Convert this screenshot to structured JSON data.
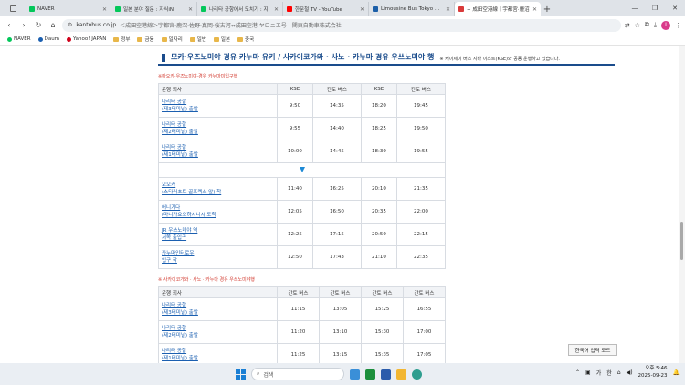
{
  "browser": {
    "tabs": [
      {
        "title": "NAVER",
        "color": "#03c75a",
        "active": false
      },
      {
        "title": "일본 분야 질문 : 지식iN",
        "color": "#03c75a",
        "active": false
      },
      {
        "title": "나리타 공항에서 도치기 : 지",
        "color": "#03c75a",
        "active": false
      },
      {
        "title": "한문철 TV - YouTube",
        "color": "#ff0000",
        "active": false
      },
      {
        "title": "Limousine Bus Tokyo Airpo",
        "color": "#1c5fa8",
        "active": false
      },
      {
        "title": "+ 成田空港線｜宇都宮·鹿沼",
        "color": "#d93a3a",
        "active": true
      }
    ],
    "new_tab": "+",
    "address": {
      "domain": "kantobus.co.jp",
      "path": "＜成田空港線＞宇都宮·鹿沼·佐野·真岡·桜古河⇔成田空港 ヤロニエ号 - 関東自動車株式会社"
    },
    "bookmarks": [
      {
        "label": "NAVER",
        "type": "dot",
        "color": "#03c75a"
      },
      {
        "label": "Daum",
        "type": "dot",
        "color": "#1b5fb0"
      },
      {
        "label": "Yahoo! JAPAN",
        "type": "dot",
        "color": "#d0021b"
      },
      {
        "label": "정부",
        "type": "folder"
      },
      {
        "label": "금융",
        "type": "folder"
      },
      {
        "label": "일자리",
        "type": "folder"
      },
      {
        "label": "일반",
        "type": "folder"
      },
      {
        "label": "일본",
        "type": "folder"
      },
      {
        "label": "중국",
        "type": "folder"
      }
    ],
    "profile_initial": "I"
  },
  "page": {
    "route_title": "모카·우즈노미야 경유 카누마 유키 / 사카이코가와 · 사노 · 카누마 경유 우쓰노미야 행",
    "route_note": "※ 케이세이 버스 지바 이스트(KSE)와 공동 운행하고 있습니다.",
    "table1": {
      "caption": "※마오카·우즈노미야·경유 카누마미입구행",
      "headers": [
        "운행 회사",
        "KSE",
        "간토 버스",
        "KSE",
        "간토 버스"
      ],
      "rows_top": [
        {
          "stop1": "나리타 공항",
          "stop2": "(제3터미널) 출발",
          "times": [
            "9:50",
            "14:35",
            "18:20",
            "19:45"
          ]
        },
        {
          "stop1": "나리타 공항",
          "stop2": "(제2터미널) 출발",
          "times": [
            "9:55",
            "14:40",
            "18:25",
            "19:50"
          ]
        },
        {
          "stop1": "나리타 공항",
          "stop2": "(제1터미널) 출발",
          "times": [
            "10:00",
            "14:45",
            "18:30",
            "19:55"
          ]
        }
      ],
      "rows_bottom": [
        {
          "stop1": "오오카",
          "stop2": "(스타러초토 골프렉스 앞) 착",
          "times": [
            "11:40",
            "16:25",
            "20:10",
            "21:35"
          ]
        },
        {
          "stop1": "어니기다",
          "stop2": "(마니가요오하시니시 도착",
          "times": [
            "12:05",
            "16:50",
            "20:35",
            "22:00"
          ]
        },
        {
          "stop1": "JR 우쓰노미야 역",
          "stop2": "서쪽 출입구",
          "times": [
            "12:25",
            "17:15",
            "20:50",
            "22:15"
          ]
        },
        {
          "stop1": "카누마인터로우",
          "stop2": "입구 착",
          "times": [
            "12:50",
            "17:43",
            "21:10",
            "22:35"
          ]
        }
      ]
    },
    "table2": {
      "caption": "※ 사카이코가와 · 사노 · 카누마 경유 우쓰노미야행",
      "headers": [
        "운행 회사",
        "간토 버스",
        "간토 버스",
        "간토 버스",
        "간토 버스"
      ],
      "rows": [
        {
          "stop1": "나리타 공항",
          "stop2": "(제3터미널) 출발",
          "times": [
            "11:15",
            "13:05",
            "15:25",
            "16:55"
          ]
        },
        {
          "stop1": "나리타 공항",
          "stop2": "(제2터미널) 출발",
          "times": [
            "11:20",
            "13:10",
            "15:30",
            "17:00"
          ]
        },
        {
          "stop1": "나리타 공항",
          "stop2": "(제1터미널) 출발",
          "times": [
            "11:25",
            "13:15",
            "15:35",
            "17:05"
          ]
        }
      ]
    },
    "ime_tooltip": "한국어 입력 모드"
  },
  "taskbar": {
    "search_placeholder": "검색",
    "ime": "가",
    "tray_lang": "한",
    "time": "오후 5:46",
    "date": "2025-09-23"
  }
}
